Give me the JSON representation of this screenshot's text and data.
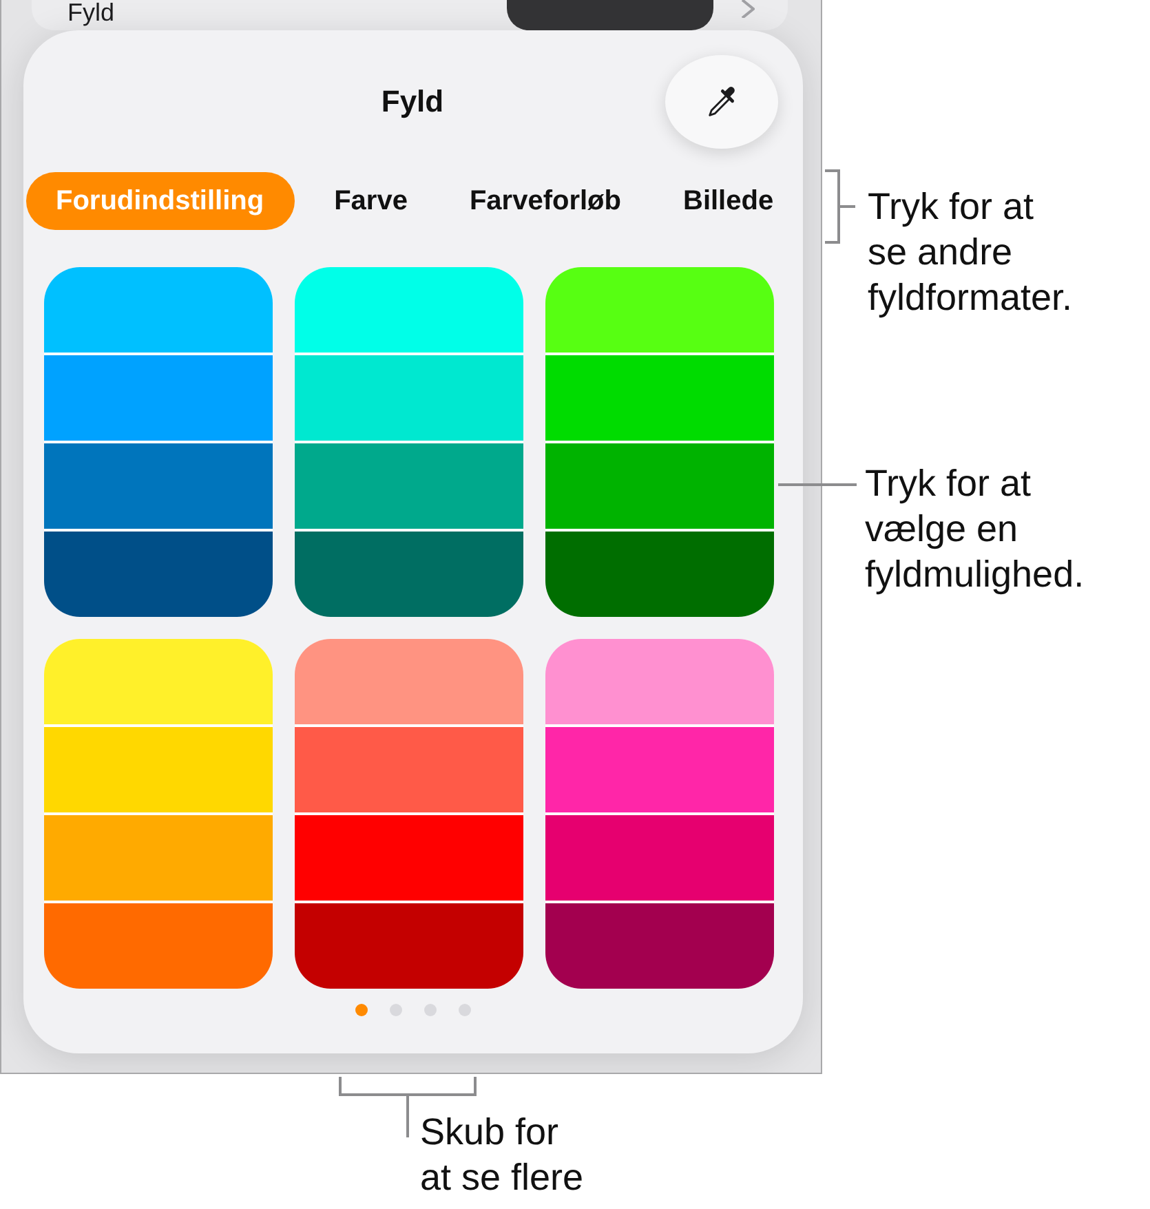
{
  "top_row": {
    "label": "Fyld"
  },
  "panel": {
    "title": "Fyld",
    "tabs": [
      {
        "label": "Forudindstilling",
        "selected": true
      },
      {
        "label": "Farve",
        "selected": false
      },
      {
        "label": "Farveforløb",
        "selected": false
      },
      {
        "label": "Billede",
        "selected": false
      }
    ],
    "swatches": [
      {
        "bands": [
          {
            "color": "#00c0ff"
          },
          {
            "color": "#00a2ff"
          },
          {
            "color": "#0075bc"
          },
          {
            "color": "#004f88"
          }
        ]
      },
      {
        "bands": [
          {
            "color": "#00ffe8"
          },
          {
            "color": "#00e8d0"
          },
          {
            "color": "#00a98c"
          },
          {
            "color": "#006e62"
          }
        ]
      },
      {
        "bands": [
          {
            "color": "#57ff12"
          },
          {
            "color": "#00dc00"
          },
          {
            "color": "#00b300"
          },
          {
            "color": "#006e00"
          }
        ]
      },
      {
        "bands": [
          {
            "color": "#fff02a"
          },
          {
            "color": "#ffd800"
          },
          {
            "color": "#ffaa00"
          },
          {
            "color": "#ff6a00"
          }
        ]
      },
      {
        "bands": [
          {
            "color": "#ff9381"
          },
          {
            "color": "#ff5a48"
          },
          {
            "color": "#ff0000"
          },
          {
            "color": "#c40000"
          }
        ]
      },
      {
        "bands": [
          {
            "color": "#ff90d0"
          },
          {
            "color": "#ff26a8"
          },
          {
            "color": "#e6006f"
          },
          {
            "color": "#a3004f"
          }
        ]
      }
    ],
    "page_dots": [
      {
        "selected": true
      },
      {
        "selected": false
      },
      {
        "selected": false
      },
      {
        "selected": false
      }
    ]
  },
  "callouts": [
    {
      "kind": "side_bracket",
      "lines": [
        "Tryk for at",
        "se andre",
        "fyldformater."
      ]
    },
    {
      "kind": "leader",
      "lines": [
        "Tryk for at",
        "vælge en",
        "fyldmulighed."
      ]
    },
    {
      "kind": "bottom_bracket",
      "lines": [
        "Skub for",
        "at se flere"
      ]
    }
  ]
}
